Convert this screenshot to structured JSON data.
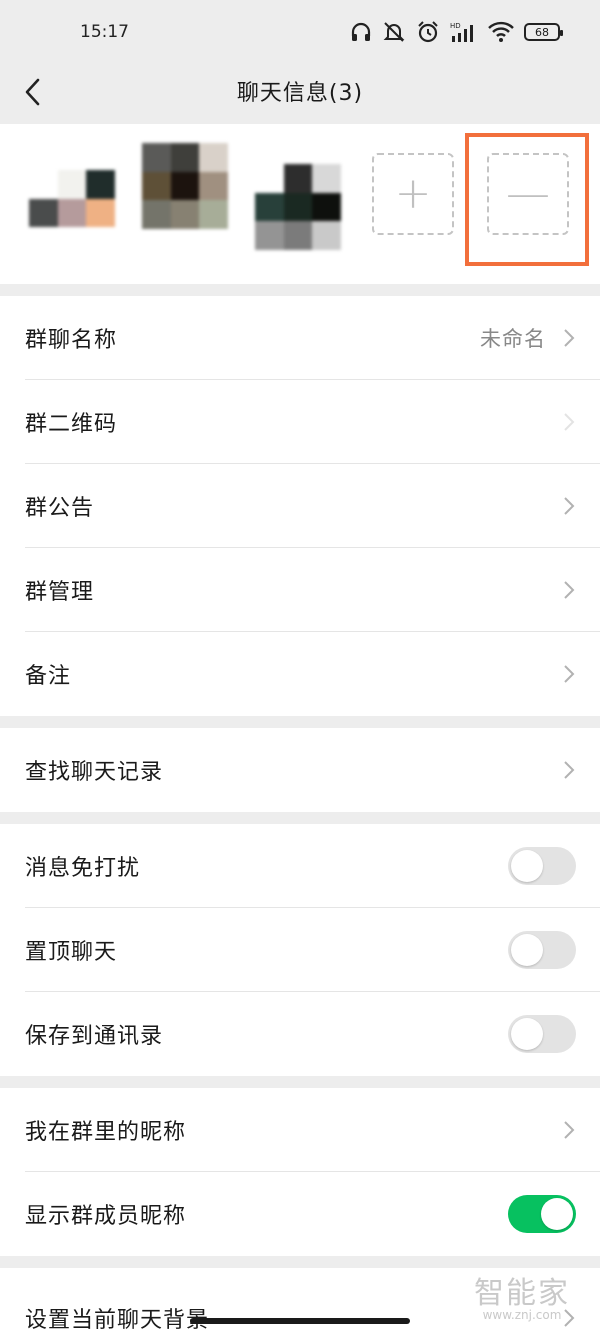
{
  "status_bar": {
    "time": "15:17",
    "battery": "68",
    "icons": [
      "headphones-icon",
      "mute-icon",
      "alarm-icon",
      "hd-signal-icon",
      "wifi-icon",
      "battery-icon"
    ]
  },
  "header": {
    "title": "聊天信息(3)",
    "back_icon": "chevron-left-icon"
  },
  "members": {
    "add_label": "+",
    "remove_label": "—",
    "highlight_color": "#f26f3c",
    "avatars": [
      {
        "colors": [
          "#ffffff",
          "#f2f2ee",
          "#202d2b",
          "#4a4c4c",
          "#b59b9c",
          "#efb184",
          "#ffffff",
          "#ffffff",
          "#ffffff"
        ]
      },
      {
        "colors": [
          "#5a5a58",
          "#3f3f3b",
          "#d9d1c9",
          "#5e5037",
          "#1c130e",
          "#a09080",
          "#74746a",
          "#878172",
          "#a7ad98"
        ]
      },
      {
        "colors": [
          "#ffffff",
          "#2d2d2d",
          "#d8d8d8",
          "#28403a",
          "#1a2922",
          "#0e100d",
          "#949494",
          "#7b7b7b",
          "#c9c9c9"
        ]
      }
    ]
  },
  "sections": {
    "group_info": [
      {
        "label": "群聊名称",
        "value": "未命名"
      },
      {
        "label": "群二维码",
        "value": ""
      },
      {
        "label": "群公告",
        "value": ""
      },
      {
        "label": "群管理",
        "value": ""
      },
      {
        "label": "备注",
        "value": ""
      }
    ],
    "search": [
      {
        "label": "查找聊天记录"
      }
    ],
    "toggles": [
      {
        "label": "消息免打扰",
        "on": false
      },
      {
        "label": "置顶聊天",
        "on": false
      },
      {
        "label": "保存到通讯录",
        "on": false
      }
    ],
    "nickname": [
      {
        "label": "我在群里的昵称"
      },
      {
        "label": "显示群成员昵称",
        "on": true
      }
    ],
    "background": [
      {
        "label": "设置当前聊天背景"
      }
    ]
  },
  "watermark": {
    "line1": "智能家",
    "line2": "www.znj.com"
  },
  "colors": {
    "accent_green": "#07c160",
    "page_bg": "#ededed"
  }
}
